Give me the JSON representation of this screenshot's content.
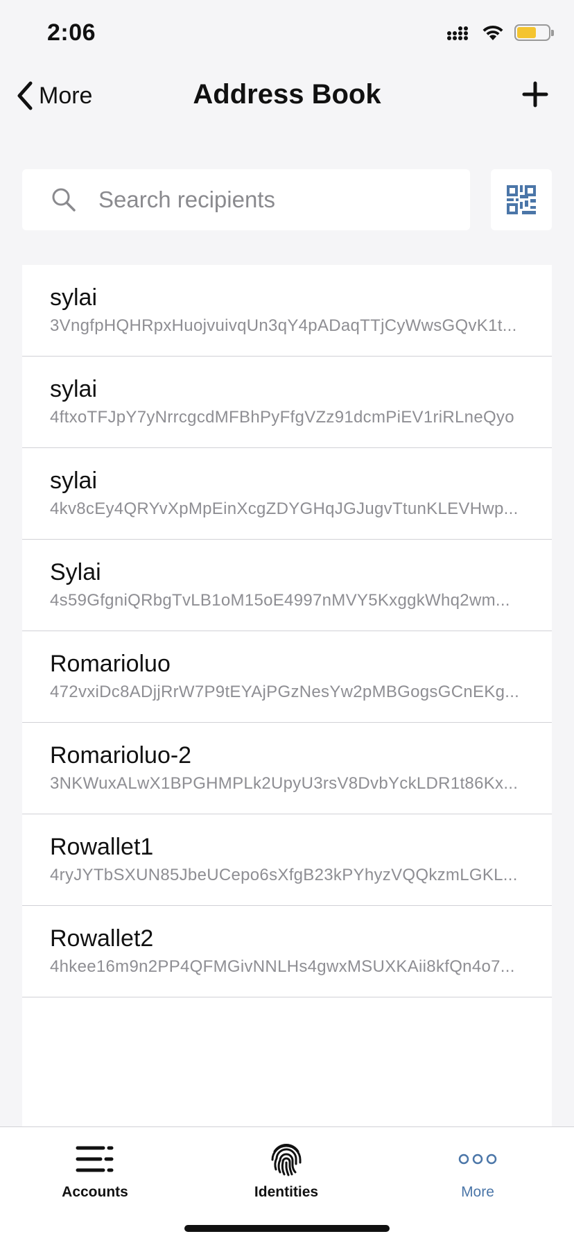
{
  "status_bar": {
    "time": "2:06"
  },
  "nav": {
    "back_label": "More",
    "title": "Address Book"
  },
  "search": {
    "placeholder": "Search recipients",
    "value": ""
  },
  "recipients": [
    {
      "name": "sylai",
      "address": "3VngfpHQHRpxHuojvuivqUn3qY4pADaqTTjCyWwsGQvK1t..."
    },
    {
      "name": "sylai",
      "address": "4ftxoTFJpY7yNrrcgcdMFBhPyFfgVZz91dcmPiEV1riRLneQyo"
    },
    {
      "name": "sylai",
      "address": "4kv8cEy4QRYvXpMpEinXcgZDYGHqJGJugvTtunKLEVHwp..."
    },
    {
      "name": "Sylai",
      "address": "4s59GfgniQRbgTvLB1oM15oE4997nMVY5KxggkWhq2wm..."
    },
    {
      "name": "Romarioluo",
      "address": "472vxiDc8ADjjRrW7P9tEYAjPGzNesYw2pMBGogsGCnEKg..."
    },
    {
      "name": "Romarioluo-2",
      "address": "3NKWuxALwX1BPGHMPLk2UpyU3rsV8DvbYckLDR1t86Kx..."
    },
    {
      "name": "Rowallet1",
      "address": "4ryJYTbSXUN85JbeUCepo6sXfgB23kPYhyzVQQkzmLGKL..."
    },
    {
      "name": "Rowallet2",
      "address": "4hkee16m9n2PP4QFMGivNNLHs4gwxMSUXKAii8kfQn4o7..."
    }
  ],
  "tabs": [
    {
      "label": "Accounts",
      "icon": "list-icon"
    },
    {
      "label": "Identities",
      "icon": "fingerprint-icon"
    },
    {
      "label": "More",
      "icon": "more-dots-icon",
      "active": true
    }
  ],
  "colors": {
    "accent": "#4b76a8",
    "background": "#f5f5f7",
    "battery": "#f4c430"
  }
}
